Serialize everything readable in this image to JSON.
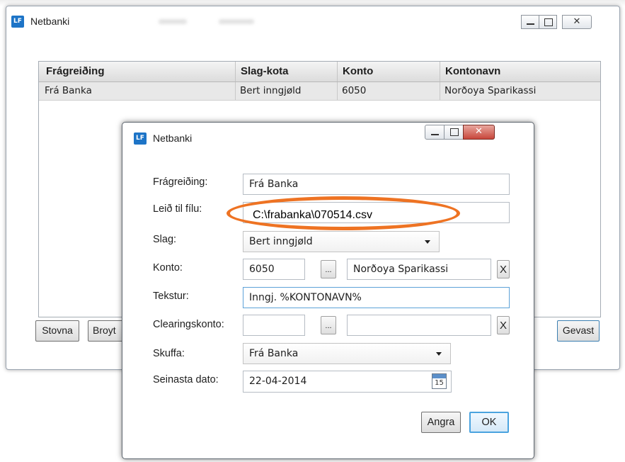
{
  "background_window": {
    "title": "Netbanki",
    "icon_text": "LF",
    "grid": {
      "columns": [
        "Frágreiðing",
        "Slag-kota",
        "Konto",
        "Kontonavn"
      ],
      "rows": [
        [
          "Frá Banka",
          "Bert inngjøld",
          "6050",
          "Norðoya Sparikassi"
        ]
      ]
    },
    "buttons": {
      "delete": "Stovna",
      "edit_partial": "Broyt",
      "save": "Gevast"
    }
  },
  "dialog": {
    "title": "Netbanki",
    "icon_text": "LF",
    "labels": {
      "description": "Frágreiðing:",
      "file_path": "Leið til fílu:",
      "type": "Slag:",
      "account": "Konto:",
      "text": "Tekstur:",
      "clearing_account": "Clearingskonto:",
      "drawer": "Skuffa:",
      "last_date": "Seinasta dato:"
    },
    "values": {
      "description": "Frá Banka",
      "file_path": "C:\\frabanka\\070514.csv",
      "type": "Bert inngjøld",
      "account_number": "6050",
      "account_name": "Norðoya Sparikassi",
      "text": "Inngj. %KONTONAVN%",
      "clearing_account_number": "",
      "clearing_account_name": "",
      "drawer": "Frá Banka",
      "last_date": "22-04-2014"
    },
    "buttons": {
      "browse": "...",
      "clear": "X",
      "cancel": "Angra",
      "ok": "OK"
    },
    "calendar_day": "15"
  },
  "colors": {
    "highlight_oval": "#ee7323",
    "close_button": "#c8463b",
    "icon_blue": "#1d74c7",
    "row_selected": "#e8e8e8"
  }
}
